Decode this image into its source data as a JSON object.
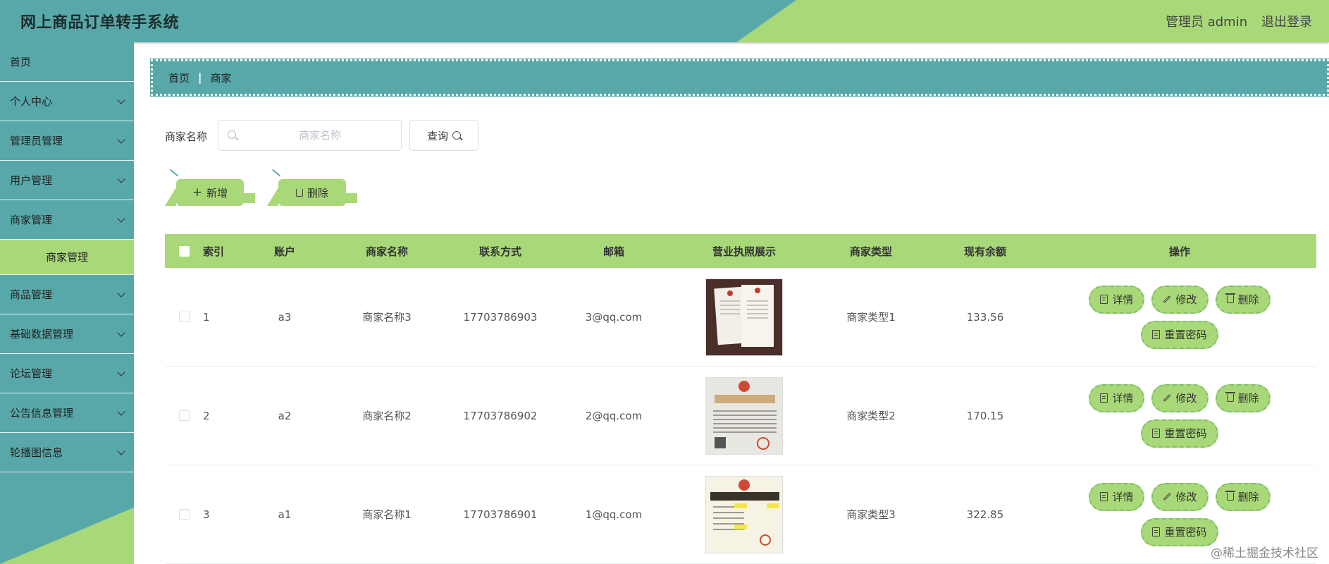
{
  "header": {
    "title": "网上商品订单转手系统",
    "user": "管理员 admin",
    "logout": "退出登录"
  },
  "sidebar": {
    "items": [
      {
        "label": "首页",
        "has_arrow": false
      },
      {
        "label": "个人中心",
        "has_arrow": true
      },
      {
        "label": "管理员管理",
        "has_arrow": true
      },
      {
        "label": "用户管理",
        "has_arrow": true
      },
      {
        "label": "商家管理",
        "has_arrow": true
      },
      {
        "label": "商家管理",
        "has_arrow": false,
        "submenu": true,
        "active": true
      },
      {
        "label": "商品管理",
        "has_arrow": true
      },
      {
        "label": "基础数据管理",
        "has_arrow": true
      },
      {
        "label": "论坛管理",
        "has_arrow": true
      },
      {
        "label": "公告信息管理",
        "has_arrow": true
      },
      {
        "label": "轮播图信息",
        "has_arrow": true
      }
    ]
  },
  "breadcrumb": {
    "home": "首页",
    "current": "商家"
  },
  "search": {
    "label": "商家名称",
    "placeholder": "商家名称",
    "value": "",
    "button": "查询"
  },
  "actions": {
    "add": "新增",
    "delete": "删除"
  },
  "table": {
    "headers": [
      "索引",
      "账户",
      "商家名称",
      "联系方式",
      "邮箱",
      "营业执照展示",
      "商家类型",
      "现有余额",
      "操作"
    ],
    "rows": [
      {
        "index": "1",
        "account": "a3",
        "name": "商家名称3",
        "phone": "17703786903",
        "email": "3@qq.com",
        "type": "商家类型1",
        "balance": "133.56"
      },
      {
        "index": "2",
        "account": "a2",
        "name": "商家名称2",
        "phone": "17703786902",
        "email": "2@qq.com",
        "type": "商家类型2",
        "balance": "170.15"
      },
      {
        "index": "3",
        "account": "a1",
        "name": "商家名称1",
        "phone": "17703786901",
        "email": "1@qq.com",
        "type": "商家类型3",
        "balance": "322.85"
      }
    ],
    "ops": {
      "detail": "详情",
      "edit": "修改",
      "delete": "删除",
      "reset": "重置密码"
    }
  },
  "watermark": "@稀土掘金技术社区",
  "colors": {
    "teal": "#59a8a9",
    "green": "#a9d879"
  }
}
